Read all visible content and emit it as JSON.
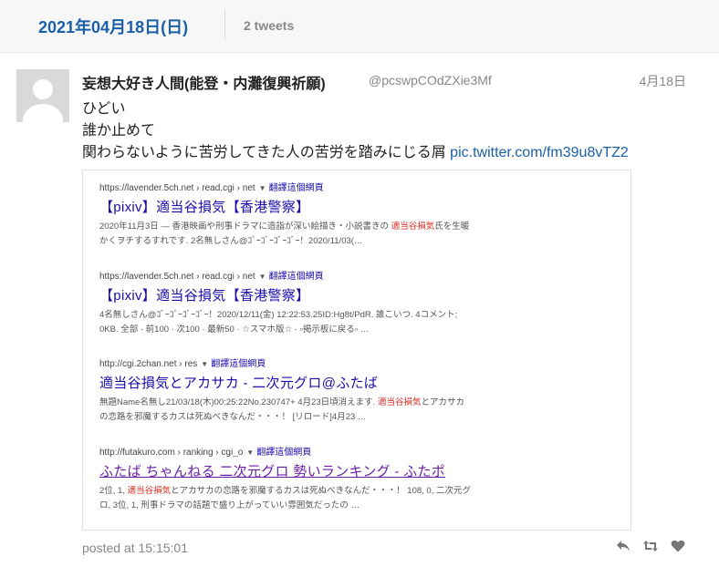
{
  "day": {
    "title": "2021年04月18日(日)",
    "count": "2 tweets"
  },
  "tweet": {
    "name": "妄想大好き人間(能登・内灘復興祈願)",
    "handle": "@pcswpCOdZXie3Mf",
    "date": "4月18日",
    "lines": [
      "ひどい",
      "誰か止めて",
      "関わらないように苦労してきた人の苦労を踏みにじる屑 "
    ],
    "link": "pic.twitter.com/fm39u8vTZ2",
    "posted": "posted at 15:15:01"
  },
  "media": {
    "translate_label": "翻譯這個網頁",
    "results": [
      {
        "url": "https://lavender.5ch.net › read.cgi › net",
        "title": "【pixiv】適当谷損気【香港警察】",
        "snippet": [
          {
            "pre": "2020年11月3日 — 香港映画や刑事ドラマに造詣が深い絵描き・小説書きの ",
            "hl": "適当谷損気",
            "post": "氏を生暖"
          },
          {
            "pre": "かくヲチするすれです. 2名無しさん@ｺﾞｰｺﾞｰｺﾞｰｺﾞｰ！2020/11/03(…",
            "hl": "",
            "post": ""
          }
        ]
      },
      {
        "url": "https://lavender.5ch.net › read.cgi › net",
        "title": "【pixiv】適当谷損気【香港警察】",
        "snippet": [
          {
            "pre": "4名無しさん@ｺﾞｰｺﾞｰｺﾞｰｺﾞｰ！2020/12/11(金) 12:22:53.25ID:Hg8t/PdR. 誰こいつ. 4コメント;",
            "hl": "",
            "post": ""
          },
          {
            "pre": "0KB. 全部 · 前100 · 次100 · 最新50 · ☆スマホ版☆ · ▫掲示板に戻る▫ …",
            "hl": "",
            "post": ""
          }
        ]
      },
      {
        "url": "http://cgi.2chan.net › res",
        "title": "適当谷損気とアカサカ - 二次元グロ@ふたば",
        "snippet": [
          {
            "pre": "無題Name名無し21/03/18(木)00:25:22No.230747+ 4月23日頃消えます. ",
            "hl": "適当谷損気",
            "post": "とアカサカ"
          },
          {
            "pre": "の恋路を邪魔するカスは死ぬべきなんだ・・・！ [リロード]4月23 …",
            "hl": "",
            "post": ""
          }
        ]
      },
      {
        "url": "http://futakuro.com › ranking › cgi_o",
        "title": "ふたば ちゃんねる 二次元グロ 勢いランキング - ふたポ",
        "snippet": [
          {
            "pre": "2位, 1, ",
            "hl": "適当谷損気",
            "post": "とアカサカの恋路を邪魔するカスは死ぬべきなんだ・・・！ 108, 0, 二次元グ"
          },
          {
            "pre": "ロ, 3位, 1, 刑事ドラマの話題で盛り上がっていい雰囲気だったの …",
            "hl": "",
            "post": ""
          }
        ]
      }
    ]
  }
}
